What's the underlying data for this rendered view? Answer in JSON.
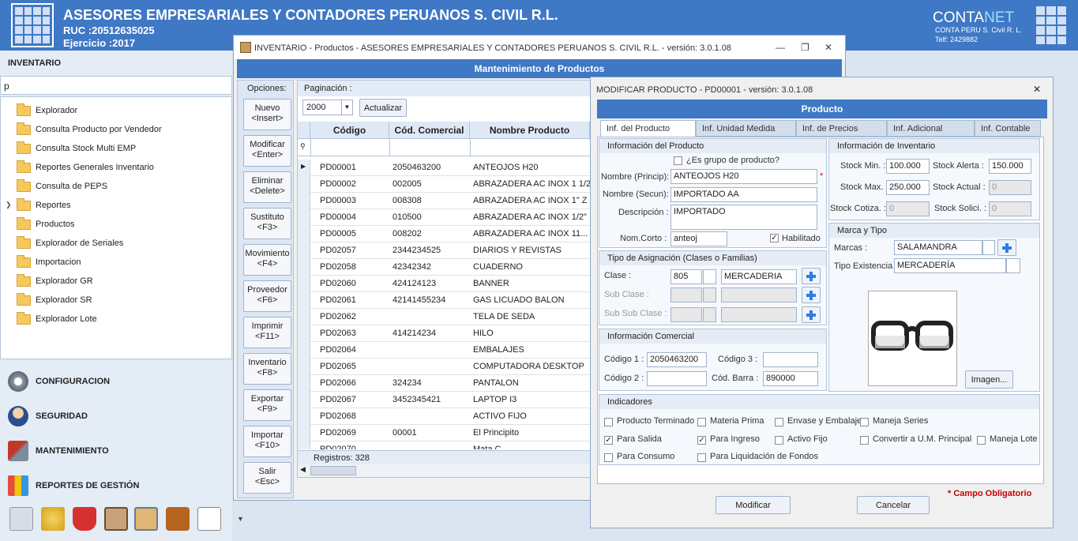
{
  "header": {
    "company": "ASESORES EMPRESARIALES Y CONTADORES PERUANOS S. CIVIL R.L.",
    "ruc": "RUC :20512635025",
    "ejercicio": "Ejercicio :2017",
    "brand_a": "CONTA",
    "brand_b": "NET",
    "brand_sub": "CONTA PERU S. Civil R. L.",
    "brand_tel": "Telf: 2429882"
  },
  "left": {
    "title": "INVENTARIO",
    "search": "p",
    "items": [
      "Explorador",
      "Consulta Producto por Vendedor",
      "Consulta Stock Multi EMP",
      "Reportes Generales Inventario",
      "Consulta de PEPS",
      "Reportes",
      "Productos",
      "Explorador de Seriales",
      "Importacion",
      "Explorador GR",
      "Explorador SR",
      "Explorador Lote"
    ],
    "nav": [
      "CONFIGURACION",
      "SEGURIDAD",
      "MANTENIMIENTO",
      "REPORTES DE GESTIÓN"
    ]
  },
  "inv": {
    "title": "INVENTARIO - Productos - ASESORES EMPRESARIALES Y CONTADORES PERUANOS S. CIVIL R.L. - versión: 3.0.1.08",
    "bar": "Mantenimiento de Productos",
    "opciones": "Opciones:",
    "buttons": [
      [
        "Nuevo",
        "<Insert>"
      ],
      [
        "Modificar",
        "<Enter>"
      ],
      [
        "Eliminar",
        "<Delete>"
      ],
      [
        "Sustituto",
        "<F3>"
      ],
      [
        "Movimiento",
        "<F4>"
      ],
      [
        "Proveedor",
        "<F6>"
      ],
      [
        "Imprimir",
        "<F11>"
      ],
      [
        "Inventario",
        "<F8>"
      ],
      [
        "Exportar",
        "<F9>"
      ],
      [
        "Importar",
        "<F10>"
      ],
      [
        "Salir",
        "<Esc>"
      ]
    ],
    "paginacion": "Paginación :",
    "page_size": "2000",
    "actualizar": "Actualizar",
    "columns": [
      "Código",
      "Cód. Comercial",
      "Nombre Producto"
    ],
    "rows": [
      [
        "PD00001",
        "2050463200",
        "ANTEOJOS H20"
      ],
      [
        "PD00002",
        "002005",
        "ABRAZADERA AC INOX 1 1/2\""
      ],
      [
        "PD00003",
        "008308",
        "ABRAZADERA AC INOX 1\" Z"
      ],
      [
        "PD00004",
        "010500",
        "ABRAZADERA AC INOX 1/2\""
      ],
      [
        "PD00005",
        "008202",
        "ABRAZADERA AC INOX 11..."
      ],
      [
        "PD02057",
        "2344234525",
        "DIARIOS Y REVISTAS"
      ],
      [
        "PD02058",
        "42342342",
        "CUADERNO"
      ],
      [
        "PD02060",
        "424124123",
        "BANNER"
      ],
      [
        "PD02061",
        "42141455234",
        "GAS LICUADO BALON"
      ],
      [
        "PD02062",
        "",
        "TELA DE SEDA"
      ],
      [
        "PD02063",
        "414214234",
        "HILO"
      ],
      [
        "PD02064",
        "",
        "EMBALAJES"
      ],
      [
        "PD02065",
        "",
        "COMPUTADORA DESKTOP"
      ],
      [
        "PD02066",
        "324234",
        "PANTALON"
      ],
      [
        "PD02067",
        "3452345421",
        "LAPTOP I3"
      ],
      [
        "PD02068",
        "",
        "ACTIVO FIJO"
      ],
      [
        "PD02069",
        "00001",
        "El Principito"
      ],
      [
        "PD02070",
        "",
        "Mata C"
      ]
    ],
    "registros": "Registros: 328"
  },
  "mod": {
    "title": "MODIFICAR PRODUCTO - PD00001 - versión: 3.0.1.08",
    "bar": "Producto",
    "tabs": [
      "Inf. del Producto",
      "Inf. Unidad Medida",
      "Inf. de Precios",
      "Inf. Adicional",
      "Inf. Contable"
    ],
    "info": {
      "title": "Información del Producto",
      "grupo": "¿Es grupo de producto?",
      "nombre_l": "Nombre (Princip):",
      "nombre": "ANTEOJOS H20",
      "secun_l": "Nombre (Secun):",
      "secun": "IMPORTADO AA",
      "desc_l": "Descripción :",
      "desc": "IMPORTADO",
      "corto_l": "Nom.Corto :",
      "corto": "anteoj",
      "habil": "Habilitado"
    },
    "asig": {
      "title": "Tipo de Asignación (Clases o Familias)",
      "clase_l": "Clase :",
      "clase": "805",
      "clase_n": "MERCADERIA",
      "sub_l": "Sub Clase :",
      "subsub_l": "Sub Sub Clase :"
    },
    "com": {
      "title": "Información Comercial",
      "c1_l": "Código 1 :",
      "c1": "2050463200",
      "c2_l": "Código 2 :",
      "c3_l": "Código 3 :",
      "barra_l": "Cód. Barra :",
      "barra": "890000"
    },
    "invent": {
      "title": "Información de Inventario",
      "min_l": "Stock Min. :",
      "min": "100.000",
      "alerta_l": "Stock Alerta :",
      "alerta": "150.000",
      "max_l": "Stock Max. :",
      "max": "250.000",
      "actual_l": "Stock Actual :",
      "actual": "0",
      "cotiza_l": "Stock Cotiza. :",
      "cotiza": "0",
      "solici_l": "Stock Solici. :",
      "solici": "0"
    },
    "marca": {
      "title": "Marca y Tipo",
      "marcas_l": "Marcas :",
      "marcas": "SALAMANDRA",
      "tipo_l": "Tipo Existencia",
      "tipo": "MERCADERÍA",
      "imagen": "Imagen..."
    },
    "ind": {
      "title": "Indicadores",
      "items": [
        "Producto Terminado",
        "Materia Prima",
        "Envase y Embalaje",
        "Maneja Series",
        "Para Salida",
        "Para Ingreso",
        "Activo Fijo",
        "Convertir a U.M. Principal",
        "Maneja Lote",
        "Para Consumo",
        "Para Liquidación de Fondos"
      ],
      "checked": [
        false,
        false,
        false,
        false,
        true,
        true,
        false,
        false,
        false,
        false,
        false
      ]
    },
    "modificar": "Modificar",
    "cancelar": "Cancelar",
    "obligatorio": "* Campo Obligatorio"
  }
}
